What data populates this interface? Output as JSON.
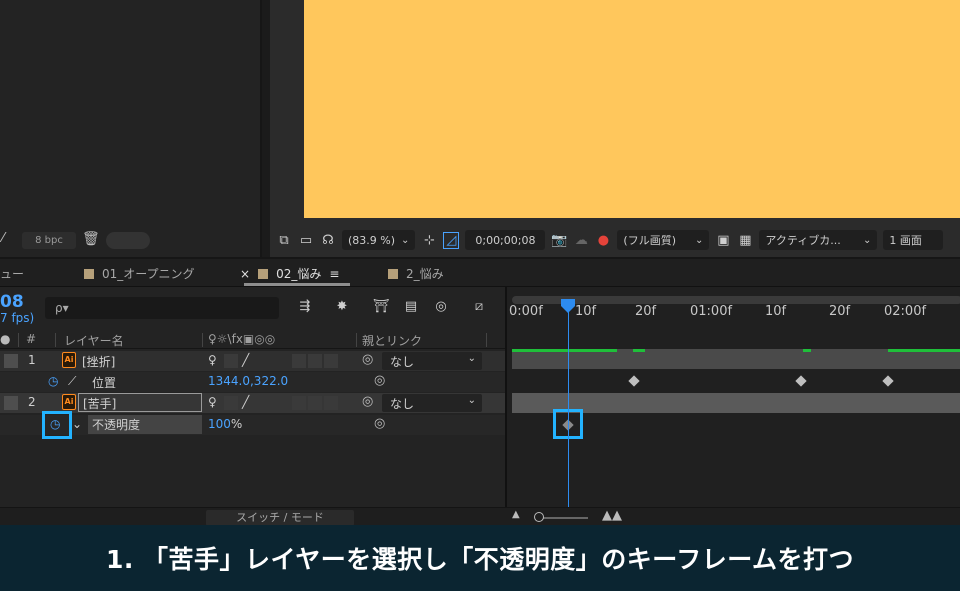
{
  "project_panel": {
    "bpc_label": "8 bpc"
  },
  "viewer_toolbar": {
    "zoom": "(83.9 %)",
    "timecode": "0;00;00;08",
    "resolution": "(フル画質)",
    "camera": "アクティブカ...",
    "views": "1 画面"
  },
  "tabs": [
    {
      "label": "ュー"
    },
    {
      "label": "01_オープニング"
    },
    {
      "label": "02_悩み",
      "active": true
    },
    {
      "label": "2_悩み"
    }
  ],
  "tab_close": "×",
  "tab_menu": "≡",
  "timeline": {
    "timecode": "08",
    "fps": "7 fps)",
    "search_placeholder": "ρ▾",
    "columns": {
      "label_icon": "●",
      "number": "#",
      "layer_name": "レイヤー名",
      "switches": "♀☼\\fx▣◎◎",
      "parent": "親とリンク"
    },
    "layers": [
      {
        "number": "1",
        "name": "[挫折]",
        "parent": "なし"
      },
      {
        "number": "2",
        "name": "[苦手]",
        "parent": "なし"
      }
    ],
    "props": [
      {
        "name": "位置",
        "value": "1344.0,322.0"
      },
      {
        "name": "不透明度",
        "value_num": "100",
        "value_unit": "%"
      }
    ],
    "ruler_labels": [
      "0:00f",
      "10f",
      "20f",
      "01:00f",
      "10f",
      "20f",
      "02:00f"
    ],
    "switch_mode": "スイッチ / モード"
  },
  "caption": "1. 「苦手」レイヤーを選択し「不透明度」のキーフレームを打つ",
  "colors": {
    "accent": "#2d8cf0",
    "highlight": "#23b3ff",
    "canvas": "#ffc75c",
    "caption_bg": "#0b2531"
  }
}
